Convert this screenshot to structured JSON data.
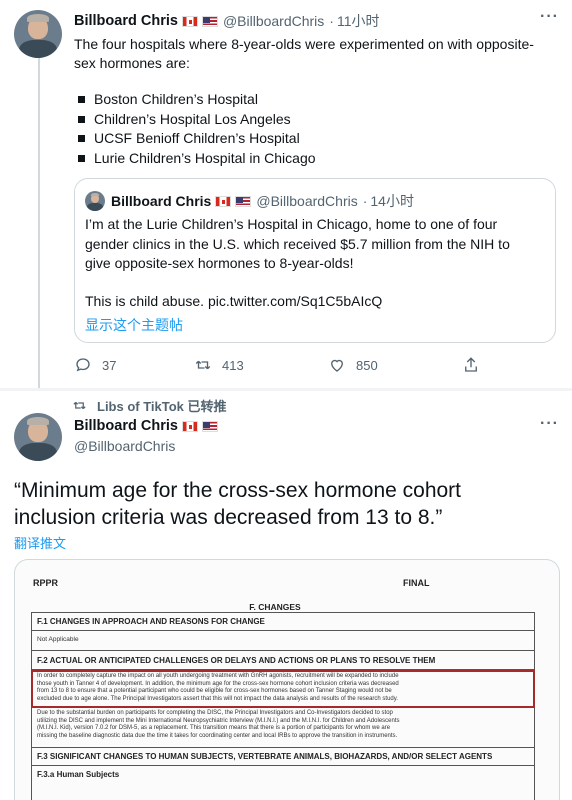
{
  "tweet1": {
    "author_name": "Billboard Chris",
    "handle": "@BillboardChris",
    "time": "11小时",
    "text_line1": "The four hospitals where 8-year-olds were experimented on with opposite-",
    "text_line2": "sex hormones are:",
    "hospitals": [
      "Boston Children’s Hospital",
      "Children’s Hospital Los Angeles",
      "UCSF Benioff Children’s Hospital",
      "Lurie Children’s Hospital in Chicago"
    ],
    "quoted": {
      "author_name": "Billboard Chris",
      "handle": "@BillboardChris",
      "time": "14小时",
      "text_line1": "I’m at the Lurie Children’s Hospital in Chicago, home to one of four",
      "text_line2": "gender clinics in the U.S. which received $5.7 million from the NIH to",
      "text_line3": "give opposite-sex hormones to 8-year-olds!",
      "text_line4": "This is child abuse. pic.twitter.com/Sq1C5bAIcQ",
      "thread_link": "显示这个主题帖"
    },
    "actions": {
      "replies": "37",
      "retweets": "413",
      "likes": "850"
    }
  },
  "tweet2": {
    "retweeted_by": "Libs of TikTok 已转推",
    "author_name": "Billboard Chris",
    "handle": "@BillboardChris",
    "text_line1": "“Minimum age for the cross-sex hormone cohort",
    "text_line2": "inclusion criteria was decreased from 13 to 8.”",
    "translate": "翻译推文",
    "document": {
      "header_left": "RPPR",
      "header_right": "FINAL",
      "section": "F. CHANGES",
      "f1_title": "F.1 CHANGES IN APPROACH AND REASONS FOR CHANGE",
      "f1_body": "Not Applicable",
      "f2_title": "F.2 ACTUAL OR ANTICIPATED CHALLENGES OR DELAYS AND ACTIONS OR PLANS TO RESOLVE THEM",
      "f2_p1_l1": "In order to completely capture the impact on all youth undergoing treatment with GnRH agonists, recruitment will be expanded to include",
      "f2_p1_l2": "those youth in Tanner 4 of development. In addition, the minimum age for the cross-sex hormone cohort inclusion criteria was decreased",
      "f2_p1_l3": "from 13 to 8 to ensure that a potential participant who could be eligible for cross-sex hormones based on Tanner Staging would not be",
      "f2_p1_l4": "excluded due to age alone. The Principal Investigators assert that this will not impact the data analysis and results of the research study.",
      "f2_p2_l1": "Due to the substantial burden on participants for completing the DISC, the Principal Investigators and Co-Investigators decided to stop",
      "f2_p2_l2": "utilizing the DISC and implement the Mini International Neuropsychiatric Interview (M.I.N.I.) and the M.I.N.I. for Children and Adolescents",
      "f2_p2_l3": "(M.I.N.I. Kid), version 7.0.2 for DSM-5, as a replacement. This transition means that there is a portion of participants for whom we are",
      "f2_p2_l4": "missing the baseline diagnostic data due the time it takes for coordinating center and local IRBs to approve the transition in instruments.",
      "f3_title": "F.3 SIGNIFICANT CHANGES TO HUMAN SUBJECTS, VERTEBRATE ANIMALS, BIOHAZARDS, AND/OR SELECT AGENTS",
      "f3a_title": "F.3.a Human Subjects"
    }
  },
  "colors": {
    "link": "#1d9bf0",
    "muted": "#536471",
    "highlight_box": "#a52a2a"
  }
}
